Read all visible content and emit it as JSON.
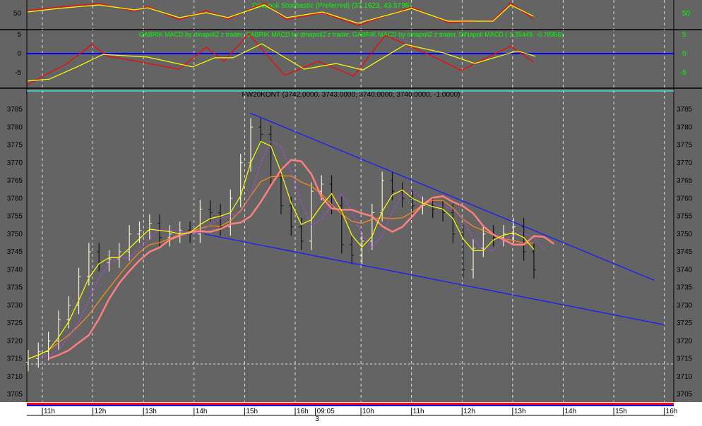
{
  "colors": {
    "panel_bg": "#646464",
    "grid": "#ffffff",
    "zero_line": "#0000ff",
    "trend": "#1a1aff",
    "yellow": "#ffff00",
    "red": "#ff0000",
    "orange": "#ff8c1a",
    "pink": "#ff7f7f",
    "purple": "#c040ff",
    "cyan": "#40e0d0",
    "green_text": "#00ff00"
  },
  "stochastic": {
    "title": "DiNapoli Stochastic (Preferred) (37.1623, 43.5798)",
    "left_ticks": [
      "50"
    ],
    "right_ticks": [
      "50"
    ],
    "yellow": [
      [
        0.71,
        54
      ],
      [
        1.31,
        64
      ],
      [
        2.12,
        74
      ],
      [
        2.82,
        60
      ],
      [
        3.08,
        66
      ],
      [
        3.71,
        38
      ],
      [
        4.24,
        52
      ],
      [
        4.67,
        38
      ],
      [
        5.39,
        74
      ],
      [
        5.83,
        38
      ],
      [
        6.54,
        54
      ],
      [
        7.24,
        22
      ],
      [
        8.3,
        64
      ],
      [
        9.02,
        28
      ],
      [
        9.91,
        28
      ],
      [
        10.26,
        74
      ],
      [
        10.71,
        42
      ]
    ],
    "red": [
      [
        0.71,
        58
      ],
      [
        1.31,
        68
      ],
      [
        2.12,
        78
      ],
      [
        2.82,
        56
      ],
      [
        3.08,
        70
      ],
      [
        3.71,
        32
      ],
      [
        4.24,
        58
      ],
      [
        4.67,
        34
      ],
      [
        5.39,
        80
      ],
      [
        5.83,
        32
      ],
      [
        6.54,
        52
      ],
      [
        7.24,
        16
      ],
      [
        8.3,
        68
      ],
      [
        9.02,
        24
      ],
      [
        9.91,
        30
      ],
      [
        10.26,
        80
      ],
      [
        10.71,
        34
      ]
    ]
  },
  "macd": {
    "title": "GABRIK MACD by dinapoli2 z trader, GABRIK MACD by dinapoli2 z trader, GABRIK MACD by dinapoli2 z trader, DiNapoli MACD (-2.35449, -0.78956)",
    "ticks": [
      "5",
      "0",
      "-5"
    ],
    "yellow": [
      [
        0.71,
        -7.2
      ],
      [
        1.14,
        -6.7
      ],
      [
        1.75,
        -3.1
      ],
      [
        2.2,
        -0.2
      ],
      [
        3.08,
        -0.9
      ],
      [
        3.97,
        -3.5
      ],
      [
        4.41,
        -1.1
      ],
      [
        4.77,
        -1.1
      ],
      [
        5.34,
        2.6
      ],
      [
        6.18,
        -4.1
      ],
      [
        6.81,
        -2.6
      ],
      [
        7.34,
        -4.3
      ],
      [
        8.18,
        2.4
      ],
      [
        8.93,
        0.2
      ],
      [
        9.55,
        -2.6
      ],
      [
        10.39,
        0.7
      ],
      [
        10.75,
        -0.7
      ]
    ],
    "red": [
      [
        0.71,
        -8.1
      ],
      [
        1.49,
        -2.6
      ],
      [
        1.98,
        2.4
      ],
      [
        2.29,
        -0.7
      ],
      [
        2.73,
        -1.7
      ],
      [
        3.71,
        -4.1
      ],
      [
        4.24,
        1.7
      ],
      [
        4.59,
        -2.0
      ],
      [
        5.08,
        5.2
      ],
      [
        5.79,
        -5.7
      ],
      [
        6.45,
        -2.0
      ],
      [
        7.16,
        -5.9
      ],
      [
        7.78,
        4.8
      ],
      [
        8.67,
        -0.4
      ],
      [
        9.28,
        -4.4
      ],
      [
        10.26,
        2.0
      ],
      [
        10.71,
        -2.2
      ]
    ]
  },
  "chart_data": {
    "type": "candlestick",
    "title": "FW20KONT (3742.0000, 3743.0000, 3740.0000, 3740.0000, -1.0000)",
    "ylim": [
      3703,
      3790
    ],
    "y_ticks": [
      "3785",
      "3780",
      "3775",
      "3770",
      "3765",
      "3760",
      "3755",
      "3750",
      "3745",
      "3740",
      "3735",
      "3730",
      "3725",
      "3720",
      "3715",
      "3710",
      "3705"
    ],
    "x_start": 0.72,
    "x_step": 0.2,
    "closes": [
      3715,
      3717,
      3720,
      3726,
      3730,
      3738,
      3745,
      3742,
      3743,
      3745,
      3750,
      3751,
      3753,
      3749,
      3750,
      3751,
      3750,
      3757,
      3756,
      3752,
      3760,
      3770,
      3780,
      3778,
      3766,
      3758,
      3752,
      3748,
      3762,
      3764,
      3758,
      3747,
      3744,
      3748,
      3756,
      3765,
      3762,
      3760,
      3758,
      3758,
      3757,
      3756,
      3750,
      3740,
      3746,
      3750,
      3749,
      3750,
      3752,
      3745,
      3740
    ],
    "trendlines": [
      {
        "name": "upper",
        "from": [
          5.1,
          3784
        ],
        "to": [
          13.1,
          3737
        ]
      },
      {
        "name": "lower",
        "from": [
          4.2,
          3750
        ],
        "to": [
          13.3,
          3724.5
        ]
      }
    ],
    "hline": 3713.5,
    "x_labels": [
      [
        "11h",
        1
      ],
      [
        "12h",
        2
      ],
      [
        "13h",
        3
      ],
      [
        "14h",
        4
      ],
      [
        "15h",
        5
      ],
      [
        "16h",
        6
      ],
      [
        "09:05",
        6.4
      ],
      [
        "10h",
        7.3
      ],
      [
        "11h",
        8.3
      ],
      [
        "12h",
        9.3
      ],
      [
        "13h",
        10.3
      ],
      [
        "14h",
        11.3
      ],
      [
        "15h",
        12.3
      ],
      [
        "16h",
        13.3
      ]
    ],
    "day_marker": "3"
  }
}
